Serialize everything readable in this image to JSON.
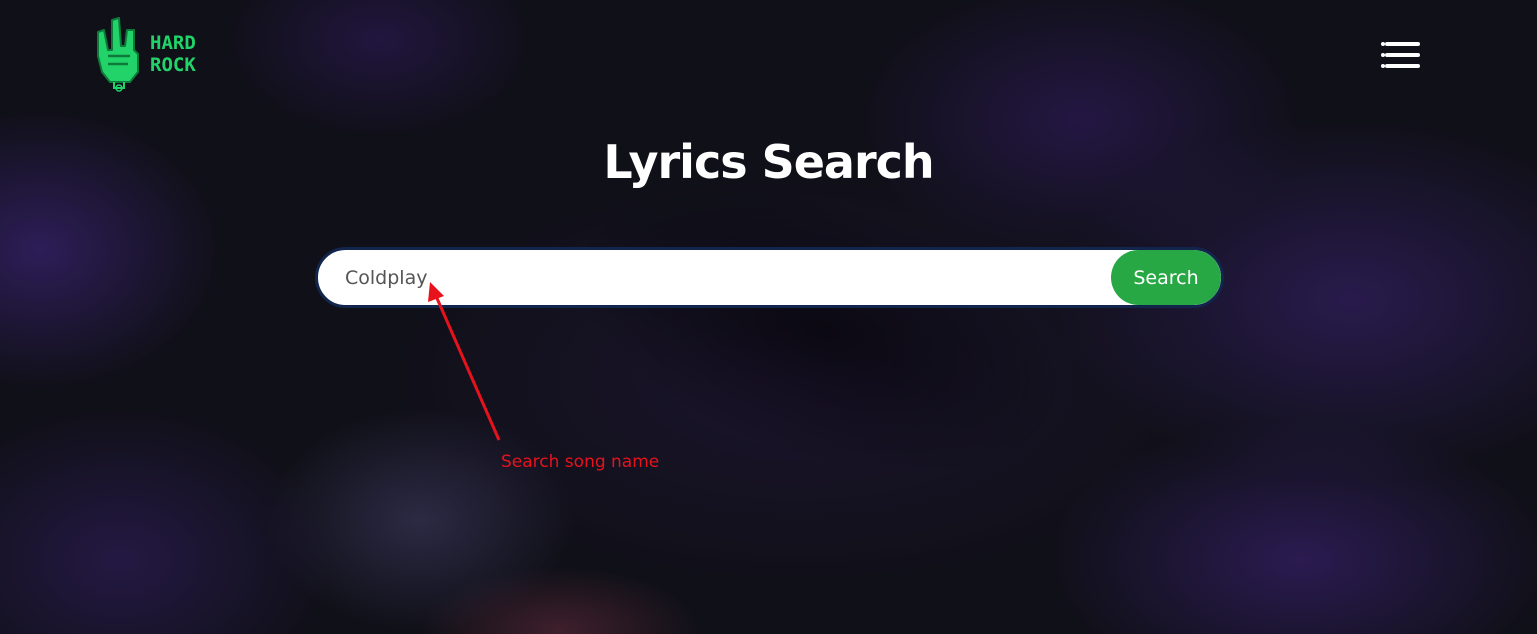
{
  "brand": {
    "logo_line1": "HARD",
    "logo_line2": "ROCK",
    "logo_icon": "rock-hand-icon",
    "accent_color": "#22d36a"
  },
  "header": {
    "menu_icon": "hamburger-menu-icon"
  },
  "main": {
    "title": "Lyrics Search",
    "search": {
      "value": "Coldplay",
      "button_label": "Search",
      "button_color": "#27a844"
    }
  },
  "annotation": {
    "label": "Search song name",
    "color": "#e8121c"
  }
}
